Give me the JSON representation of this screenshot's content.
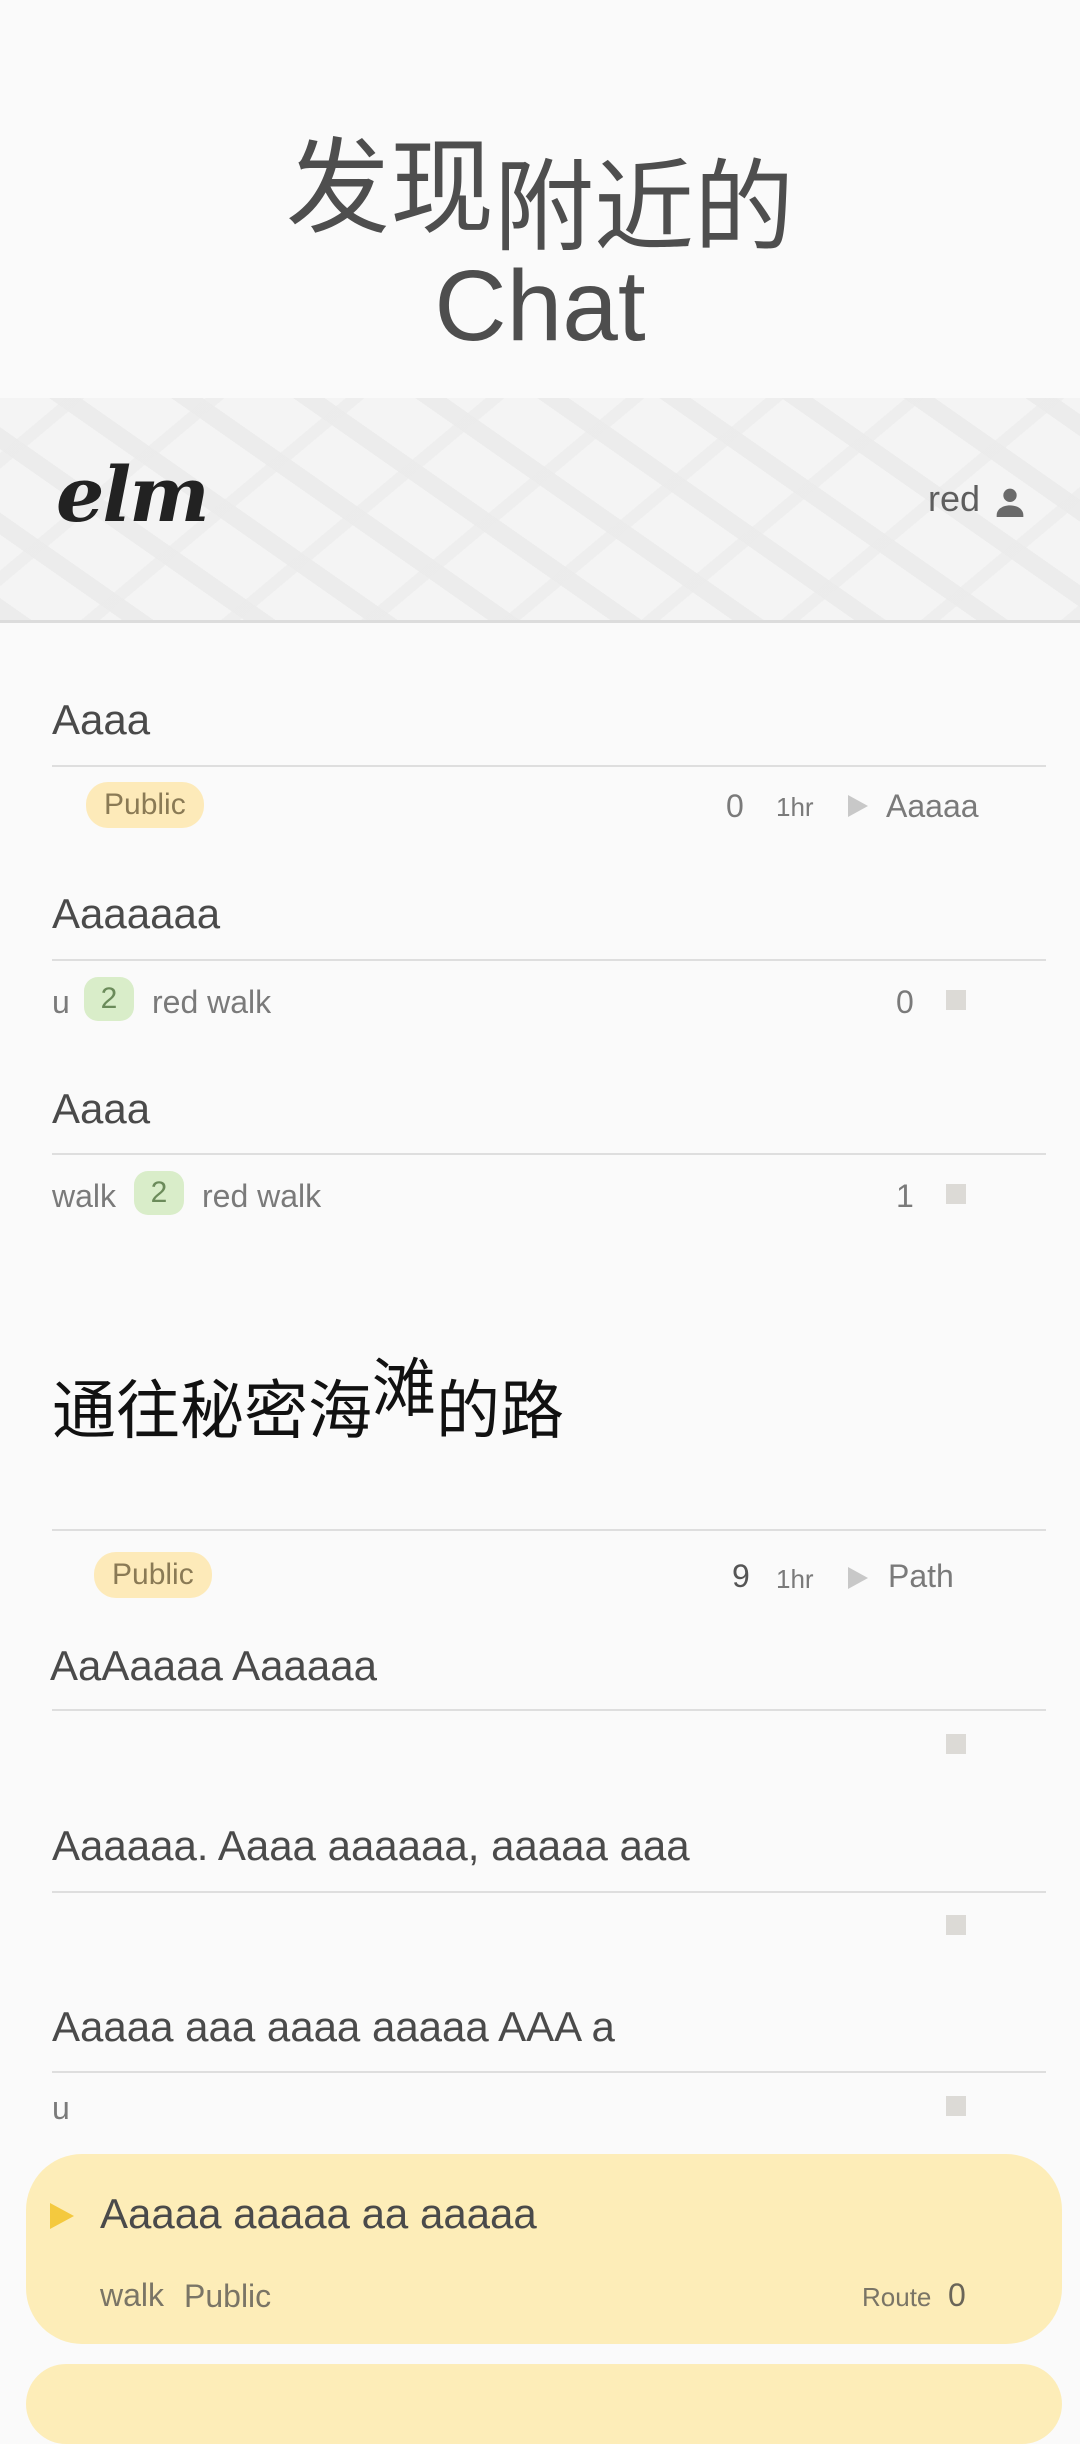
{
  "hero": {
    "line1_part1": "发现",
    "line1_part2": "附近的",
    "line2": "Chat"
  },
  "header": {
    "logo": "elm",
    "username": "red"
  },
  "chats": [
    {
      "title": "Aaaa",
      "tag": "Public",
      "count": "0",
      "age": "1hr",
      "last": "Aaaaa"
    },
    {
      "title": "Aaaaaaa",
      "user": "u",
      "badge": "2",
      "people": "red walk",
      "count": "0"
    },
    {
      "title": "Aaaa",
      "user": "walk",
      "badge": "2",
      "people": "red walk",
      "count": "1"
    }
  ],
  "section": {
    "title_part1": "通往秘密海",
    "title_part2": "滩",
    "title_part3": "的路"
  },
  "route": {
    "tag": "Public",
    "count": "9",
    "age": "1hr",
    "label": "Path",
    "messages": [
      {
        "text": "AaAaaaa Aaaaaa",
        "author": ""
      },
      {
        "text": "Aaaaaa. Aaaa aaaaaa, aaaaa aaa",
        "author": ""
      },
      {
        "text": "Aaaaa aaa aaaa aaaaa AAA a",
        "author": "u"
      }
    ]
  },
  "card": {
    "title": "Aaaaa aaaaa aa aaaaa",
    "user": "walk",
    "tag": "Public",
    "type": "Route",
    "count": "0"
  },
  "colors": {
    "public_pill": "#fdeab9",
    "badge_green": "#d9edc9",
    "card_bg": "#fdedb8",
    "accent": "#f4c93e"
  }
}
